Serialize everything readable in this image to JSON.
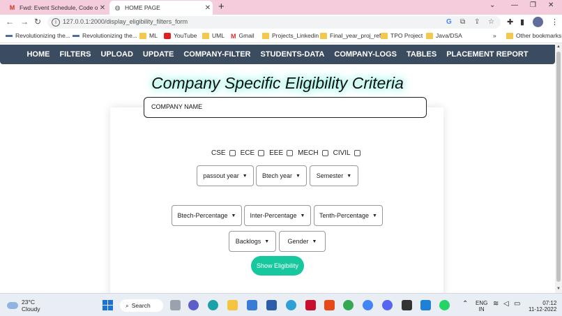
{
  "browser": {
    "tabs": [
      {
        "title": "Fwd: Event Schedule, Code of Co",
        "favicon": "gmail-icon",
        "active": false
      },
      {
        "title": "HOME PAGE",
        "favicon": "globe-icon",
        "active": true
      }
    ],
    "url": "127.0.0.1:2000/display_eligibility_filters_form",
    "bookmarks": [
      {
        "label": "Revolutionizing the...",
        "icon": "site-icon"
      },
      {
        "label": "Revolutionizing the...",
        "icon": "site-icon"
      },
      {
        "label": "ML",
        "icon": "folder-icon"
      },
      {
        "label": "YouTube",
        "icon": "youtube-icon"
      },
      {
        "label": "UML",
        "icon": "folder-icon"
      },
      {
        "label": "Gmail",
        "icon": "gmail-icon"
      },
      {
        "label": "Projects_Linkedin",
        "icon": "folder-icon"
      },
      {
        "label": "Final_year_proj_ref",
        "icon": "folder-icon"
      },
      {
        "label": "TPO Project",
        "icon": "folder-icon"
      },
      {
        "label": "Java/DSA",
        "icon": "folder-icon"
      }
    ],
    "overflow": "»",
    "other_bookmarks": "Other bookmarks"
  },
  "nav": [
    "HOME",
    "FILTERS",
    "UPLOAD",
    "UPDATE",
    "COMPANY-FILTER",
    "STUDENTS-DATA",
    "COMPANY-LOGS",
    "TABLES",
    "PLACEMENT REPORT"
  ],
  "heading": "Company Specific Eligibility Criteria",
  "form": {
    "company_placeholder": "COMPANY NAME",
    "row1": [
      "passout year",
      "Btech year",
      "Semester"
    ],
    "branches": [
      "CSE",
      "ECE",
      "EEE",
      "MECH",
      "CIVIL"
    ],
    "row2": [
      "Btech-Percentage",
      "Inter-Percentage",
      "Tenth-Percentage"
    ],
    "row3": [
      "Backlogs",
      "Gender"
    ],
    "submit": "Show Eligibility"
  },
  "taskbar": {
    "weather_temp": "23°C",
    "weather_desc": "Cloudy",
    "search": "Search",
    "lang": "ENG",
    "region": "IN",
    "time": "07:12",
    "date": "11-12-2022"
  },
  "colors": {
    "navbar": "#3c4c60",
    "button": "#17c79e",
    "tabstrip": "#f4ccdc",
    "glow": "#5fe8d4"
  }
}
